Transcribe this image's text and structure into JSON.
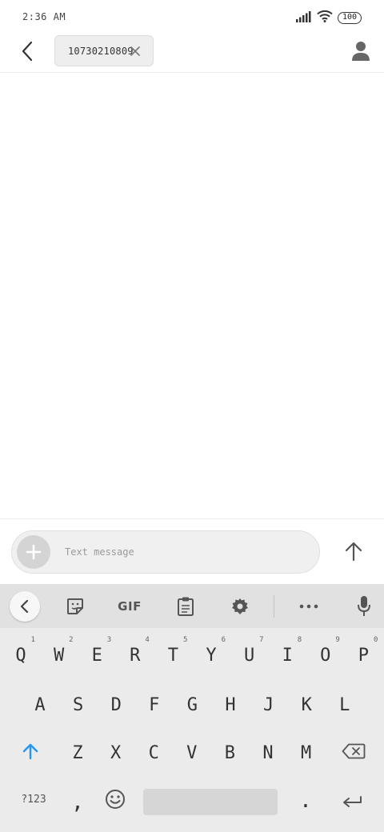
{
  "status_bar": {
    "time": "2:36 AM",
    "battery": "100",
    "icons": [
      "signal-icon",
      "wifi-icon",
      "battery-icon"
    ]
  },
  "header": {
    "back_icon": "back-arrow-icon",
    "recipient": "10730210809",
    "chip_close_icon": "close-icon",
    "contact_icon": "person-icon"
  },
  "compose": {
    "placeholder": "Text message",
    "value": "",
    "attach_icon": "plus-icon",
    "send_icon": "arrow-up-icon"
  },
  "keyboard": {
    "toolbar": {
      "items": [
        "back-chevron-icon",
        "sticker-icon",
        "GIF",
        "clipboard-icon",
        "gear-icon",
        "more-dots-icon",
        "mic-icon"
      ],
      "gif_label": "GIF"
    },
    "row1": [
      {
        "key": "Q",
        "hint": "1"
      },
      {
        "key": "W",
        "hint": "2"
      },
      {
        "key": "E",
        "hint": "3"
      },
      {
        "key": "R",
        "hint": "4"
      },
      {
        "key": "T",
        "hint": "5"
      },
      {
        "key": "Y",
        "hint": "6"
      },
      {
        "key": "U",
        "hint": "7"
      },
      {
        "key": "I",
        "hint": "8"
      },
      {
        "key": "O",
        "hint": "9"
      },
      {
        "key": "P",
        "hint": "0"
      }
    ],
    "row2": [
      "A",
      "S",
      "D",
      "F",
      "G",
      "H",
      "J",
      "K",
      "L"
    ],
    "row3": [
      "Z",
      "X",
      "C",
      "V",
      "B",
      "N",
      "M"
    ],
    "row4": {
      "symbols": "?123",
      "comma": ",",
      "period": "."
    },
    "colors": {
      "accent": "#2196f3",
      "background": "#ebebeb",
      "toolbar": "#e1e1e1"
    }
  }
}
